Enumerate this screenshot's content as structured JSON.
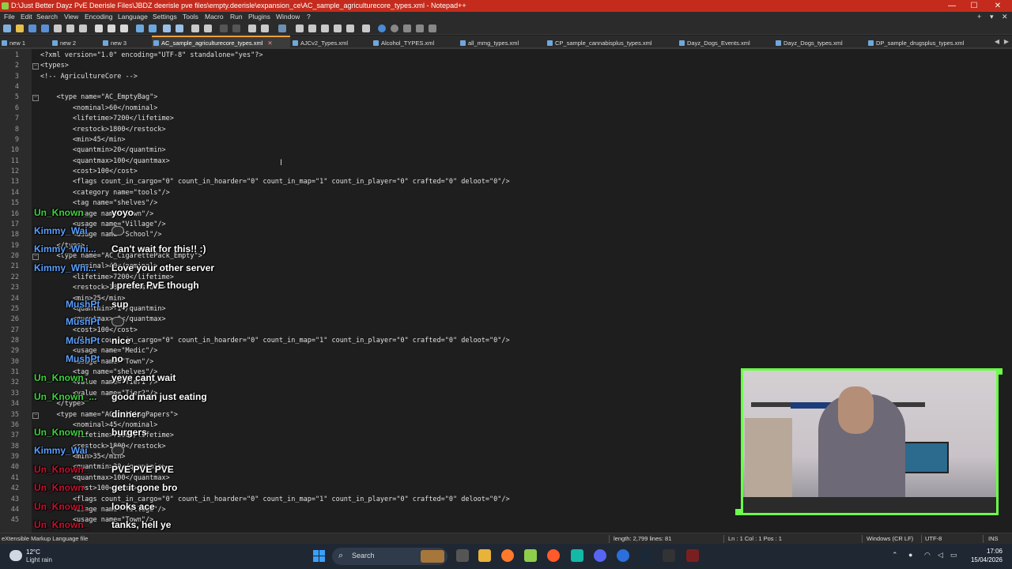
{
  "window": {
    "title": "D:\\Just Better Dayz PvE Deerisle Files\\JBDZ deerisle pve files\\empty.deerisle\\expansion_ce\\AC_sample_agriculturecore_types.xml - Notepad++",
    "buttons": {
      "minimize": "—",
      "maximize": "☐",
      "close": "✕"
    }
  },
  "menu": {
    "items": [
      "File",
      "Edit",
      "Search",
      "View",
      "Encoding",
      "Language",
      "Settings",
      "Tools",
      "Macro",
      "Run",
      "Plugins",
      "Window",
      "?"
    ],
    "right_buttons": [
      "+",
      "▾",
      "✕"
    ]
  },
  "tabs": [
    {
      "label": "new 1",
      "active": false
    },
    {
      "label": "new 2",
      "active": false
    },
    {
      "label": "new 3",
      "active": false
    },
    {
      "label": "AC_sample_agriculturecore_types.xml",
      "active": true
    },
    {
      "label": "AJCv2_Types.xml",
      "active": false
    },
    {
      "label": "Alcohol_TYPES.xml",
      "active": false
    },
    {
      "label": "all_mmg_types.xml",
      "active": false
    },
    {
      "label": "CP_sample_cannabisplus_types.xml",
      "active": false
    },
    {
      "label": "Dayz_Dogs_Events.xml",
      "active": false
    },
    {
      "label": "Dayz_Dogs_types.xml",
      "active": false
    },
    {
      "label": "DP_sample_drugsplus_types.xml",
      "active": false
    }
  ],
  "lines": [
    {
      "n": "1",
      "text": "<?xml version=\"1.0\" encoding=\"UTF-8\" standalone=\"yes\"?>"
    },
    {
      "n": "2",
      "text": "<types>"
    },
    {
      "n": "3",
      "text": "<!-- AgricultureCore -->"
    },
    {
      "n": "4",
      "text": ""
    },
    {
      "n": "5",
      "text": "    <type name=\"AC_EmptyBag\">"
    },
    {
      "n": "6",
      "text": "        <nominal>60</nominal>"
    },
    {
      "n": "7",
      "text": "        <lifetime>7200</lifetime>"
    },
    {
      "n": "8",
      "text": "        <restock>1800</restock>"
    },
    {
      "n": "9",
      "text": "        <min>45</min>"
    },
    {
      "n": "10",
      "text": "        <quantmin>20</quantmin>"
    },
    {
      "n": "11",
      "text": "        <quantmax>100</quantmax>"
    },
    {
      "n": "12",
      "text": "        <cost>100</cost>"
    },
    {
      "n": "13",
      "text": "        <flags count_in_cargo=\"0\" count_in_hoarder=\"0\" count_in_map=\"1\" count_in_player=\"0\" crafted=\"0\" deloot=\"0\"/>"
    },
    {
      "n": "14",
      "text": "        <category name=\"tools\"/>"
    },
    {
      "n": "15",
      "text": "        <tag name=\"shelves\"/>"
    },
    {
      "n": "16",
      "text": "        <usage name=\"Town\"/>"
    },
    {
      "n": "17",
      "text": "        <usage name=\"Village\"/>"
    },
    {
      "n": "18",
      "text": "        <usage name=\"School\"/>"
    },
    {
      "n": "19",
      "text": "    </type>"
    },
    {
      "n": "20",
      "text": "    <type name=\"AC_CigarettePack_Empty\">"
    },
    {
      "n": "21",
      "text": "        <nominal>40</nominal>"
    },
    {
      "n": "22",
      "text": "        <lifetime>7200</lifetime>"
    },
    {
      "n": "23",
      "text": "        <restock>1800</restock>"
    },
    {
      "n": "24",
      "text": "        <min>25</min>"
    },
    {
      "n": "25",
      "text": "        <quantmin>-1</quantmin>"
    },
    {
      "n": "26",
      "text": "        <quantmax>-1</quantmax>"
    },
    {
      "n": "27",
      "text": "        <cost>100</cost>"
    },
    {
      "n": "28",
      "text": "        <flags count_in_cargo=\"0\" count_in_hoarder=\"0\" count_in_map=\"1\" count_in_player=\"0\" crafted=\"0\" deloot=\"0\"/>"
    },
    {
      "n": "29",
      "text": "        <usage name=\"Medic\"/>"
    },
    {
      "n": "30",
      "text": "        <usage name=\"Town\"/>"
    },
    {
      "n": "31",
      "text": "        <tag name=\"shelves\"/>"
    },
    {
      "n": "32",
      "text": "        <value name=\"Tier1\"/>"
    },
    {
      "n": "33",
      "text": "        <value name=\"Tier2\"/>"
    },
    {
      "n": "34",
      "text": "    </type>"
    },
    {
      "n": "35",
      "text": "    <type name=\"AC_RollingPapers\">"
    },
    {
      "n": "36",
      "text": "        <nominal>45</nominal>"
    },
    {
      "n": "37",
      "text": "        <lifetime>7200</lifetime>"
    },
    {
      "n": "38",
      "text": "        <restock>1800</restock>"
    },
    {
      "n": "39",
      "text": "        <min>35</min>"
    },
    {
      "n": "40",
      "text": "        <quantmin>20</quantmin>"
    },
    {
      "n": "41",
      "text": "        <quantmax>100</quantmax>"
    },
    {
      "n": "42",
      "text": "        <cost>100</cost>"
    },
    {
      "n": "43",
      "text": "        <flags count_in_cargo=\"0\" count_in_hoarder=\"0\" count_in_map=\"1\" count_in_player=\"0\" crafted=\"0\" deloot=\"0\"/>"
    },
    {
      "n": "44",
      "text": "        <usage name=\"Village\"/>"
    },
    {
      "n": "45",
      "text": "        <usage name=\"Town\"/>"
    }
  ],
  "chat": [
    {
      "user": "Un_Known_",
      "color": "#3fd13f",
      "msg": "yoyo",
      "emote": false
    },
    {
      "user": "Kimmy_Wai",
      "color": "#5aa0ff",
      "msg": "",
      "emote": true
    },
    {
      "user": "Kimmy_Whi...",
      "color": "#5aa0ff",
      "msg": "Can't wait for this!! :)",
      "emote": false
    },
    {
      "user": "Kimmy_Whi...",
      "color": "#5aa0ff",
      "msg": "Love your other server",
      "emote": false
    },
    {
      "user": "",
      "color": "#5aa0ff",
      "msg": "I prefer PvE though",
      "emote": false
    },
    {
      "user": "MushPt",
      "color": "#5aa0ff",
      "msg": "sup",
      "emote": false
    },
    {
      "user": "MushPt",
      "color": "#5aa0ff",
      "msg": "",
      "emote": true
    },
    {
      "user": "MushPt",
      "color": "#5aa0ff",
      "msg": "nice",
      "emote": false
    },
    {
      "user": "MushPt",
      "color": "#5aa0ff",
      "msg": "no",
      "emote": false
    },
    {
      "user": "Un_Known_",
      "color": "#3fd13f",
      "msg": "yeye cant wait",
      "emote": false
    },
    {
      "user": "Un_Known_...",
      "color": "#3fd13f",
      "msg": "good man just eating",
      "emote": false
    },
    {
      "user": "",
      "color": "#3fd13f",
      "msg": "dinner",
      "emote": false
    },
    {
      "user": "Un_Known_",
      "color": "#3fd13f",
      "msg": "burgers",
      "emote": false
    },
    {
      "user": "Kimmy_Wai",
      "color": "#5aa0ff",
      "msg": "",
      "emote": true
    },
    {
      "user": "Un_Known_",
      "color": "#c8102e",
      "msg": "PVE PVE PVE",
      "emote": false
    },
    {
      "user": "Un_Known_",
      "color": "#c8102e",
      "msg": "get it gone bro",
      "emote": false
    },
    {
      "user": "Un_Known_",
      "color": "#c8102e",
      "msg": "looks ace",
      "emote": false
    },
    {
      "user": "Un_Known_",
      "color": "#c8102e",
      "msg": "tanks, hell ye",
      "emote": false
    }
  ],
  "status": {
    "filetype": "eXtensible Markup Language file",
    "length_lines": "length: 2,799    lines: 81",
    "position": "Ln : 1    Col : 1    Pos : 1",
    "eol": "Windows (CR LF)",
    "encoding": "UTF-8",
    "mode": "INS"
  },
  "taskbar": {
    "temperature": "12°C",
    "weather": "Light rain",
    "search_label": "Search",
    "time": "17:06",
    "date": "15/04/2026"
  },
  "colors": {
    "titlebar": "#c42b1c",
    "tag": "#e0e0e0",
    "attr_value": "#888888",
    "active_tab_accent": "#f0a23b",
    "webcam_border": "#6cff4a"
  }
}
